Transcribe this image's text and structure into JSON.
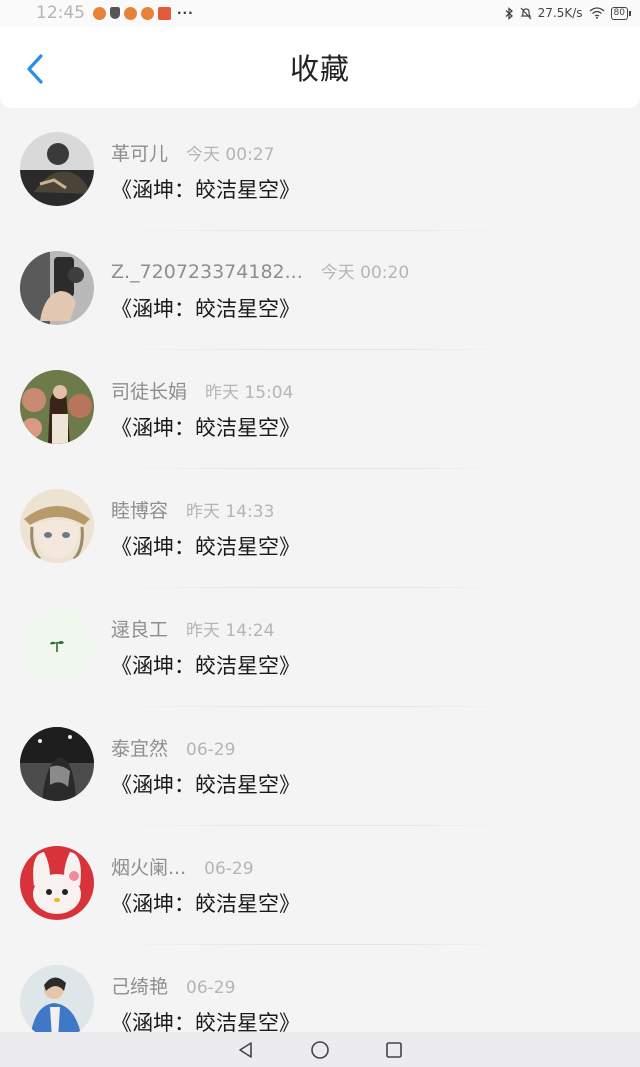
{
  "status_bar": {
    "time": "12:45",
    "network_speed": "27.5K/s",
    "battery": "80"
  },
  "header": {
    "title": "收藏",
    "back_icon": "chevron-left-icon"
  },
  "items": [
    {
      "name": "革可儿",
      "time": "今天 00:27",
      "title": "《涵坤：皎洁星空》",
      "avatar_color": "#3a3a3a"
    },
    {
      "name": "Z._720723374182...",
      "time": "今天 00:20",
      "title": "《涵坤：皎洁星空》",
      "avatar_color": "#6a6a6a"
    },
    {
      "name": "司徒长娟",
      "time": "昨天 15:04",
      "title": "《涵坤：皎洁星空》",
      "avatar_color": "#8a6a52"
    },
    {
      "name": "睦博容",
      "time": "昨天 14:33",
      "title": "《涵坤：皎洁星空》",
      "avatar_color": "#e8dccb"
    },
    {
      "name": "逯良工",
      "time": "昨天 14:24",
      "title": "《涵坤：皎洁星空》",
      "avatar_color": "#eef6ee"
    },
    {
      "name": "泰宜然",
      "time": "06-29",
      "title": "《涵坤：皎洁星空》",
      "avatar_color": "#3c3c3c"
    },
    {
      "name": "烟火阑...",
      "time": "06-29",
      "title": "《涵坤：皎洁星空》",
      "avatar_color": "#d8333a"
    },
    {
      "name": "己绮艳",
      "time": "06-29",
      "title": "《涵坤：皎洁星空》",
      "avatar_color": "#4a7ab0"
    }
  ],
  "nav_bar": {
    "back": "triangle-back-icon",
    "home": "circle-home-icon",
    "recents": "square-recents-icon"
  }
}
